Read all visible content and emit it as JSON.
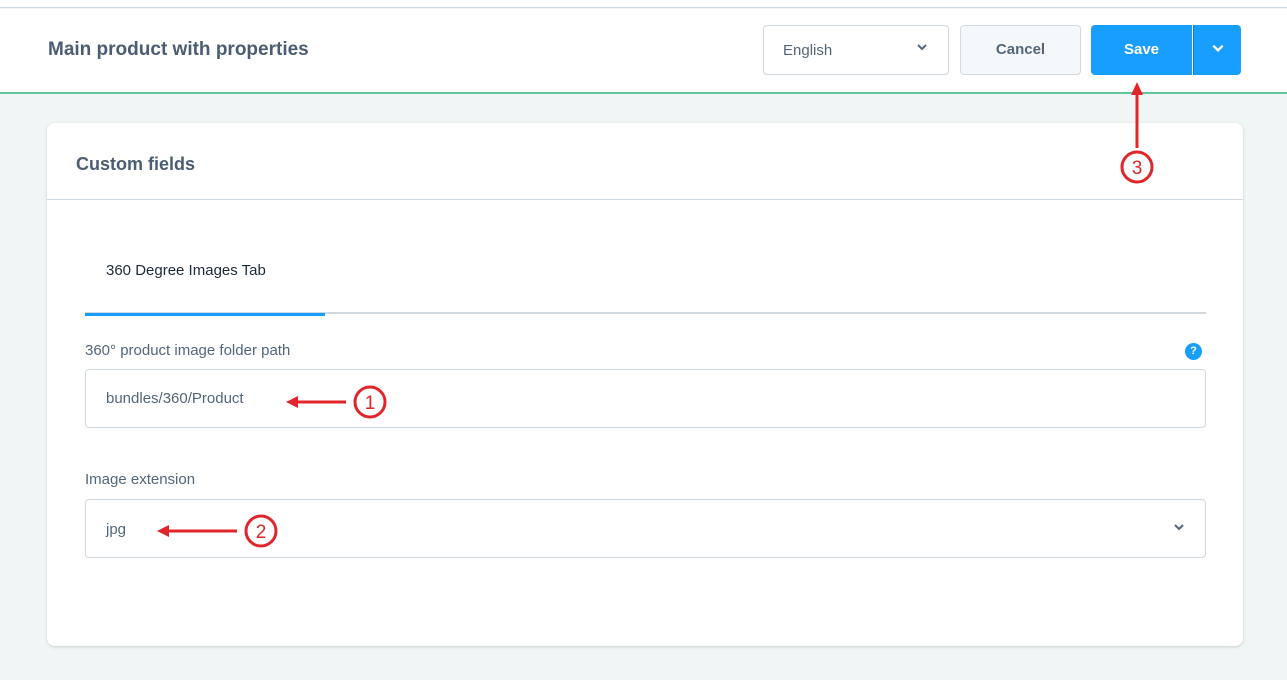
{
  "header": {
    "title": "Main product with properties",
    "language": "English",
    "cancel_label": "Cancel",
    "save_label": "Save"
  },
  "card": {
    "title": "Custom fields",
    "tabs": [
      {
        "label": "360 Degree Images Tab",
        "active": true
      }
    ],
    "fields": {
      "folder_path": {
        "label": "360° product image folder path",
        "value": "bundles/360/Product"
      },
      "extension": {
        "label": "Image extension",
        "value": "jpg"
      }
    }
  },
  "annotations": [
    {
      "number": "1",
      "target": "folder-path-input"
    },
    {
      "number": "2",
      "target": "image-extension-select"
    },
    {
      "number": "3",
      "target": "save-button"
    }
  ],
  "colors": {
    "accent": "#189eff",
    "header_border": "#5ec79a",
    "annotation": "#e0262b",
    "background": "#f0f6f5"
  },
  "icons": {
    "chevron": "chevron-down-icon",
    "help": "help-icon",
    "annotation_arrow": "arrow-icon"
  }
}
